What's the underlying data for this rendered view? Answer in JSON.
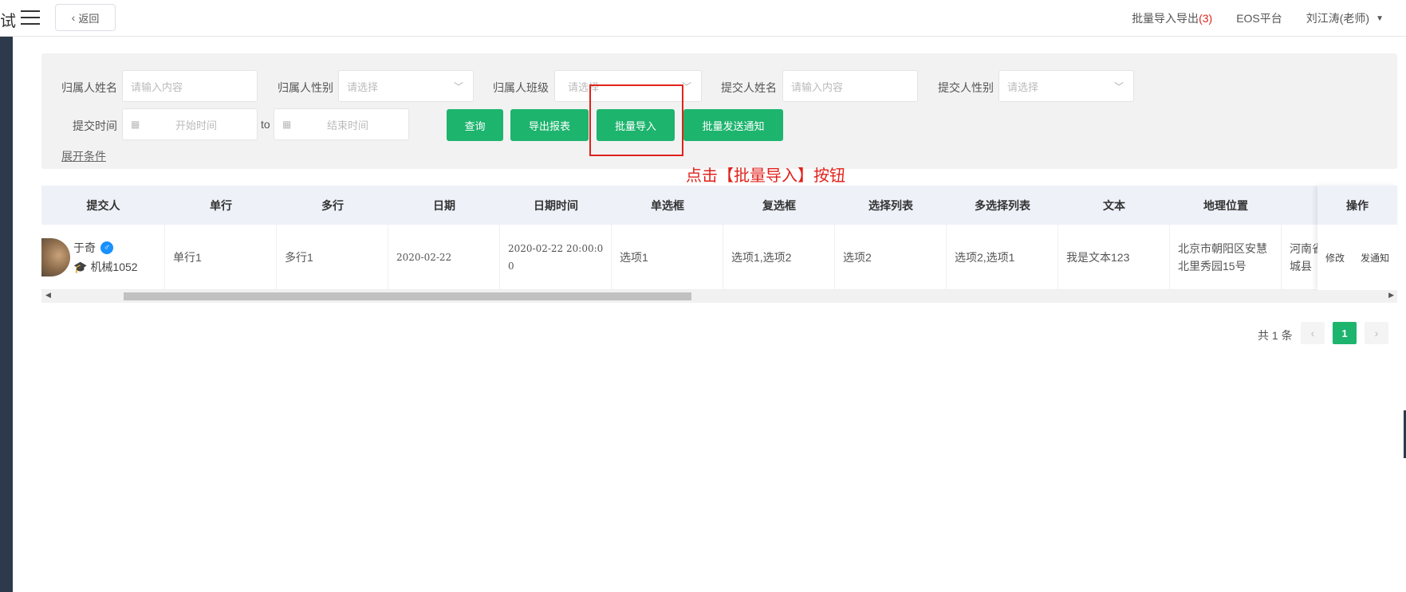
{
  "app": {
    "title_fragment": "试"
  },
  "topbar": {
    "back_label": "返回",
    "import_export_label": "批量导入导出",
    "import_export_count": "(3)",
    "eos_label": "EOS平台",
    "user_label": "刘江涛(老师)"
  },
  "filters": {
    "owner_name_label": "归属人姓名",
    "owner_name_placeholder": "请输入内容",
    "owner_gender_label": "归属人性别",
    "owner_gender_placeholder": "请选择",
    "owner_class_label": "归属人班级",
    "owner_class_placeholder": "请选择",
    "submitter_name_label": "提交人姓名",
    "submitter_name_placeholder": "请输入内容",
    "submitter_gender_label": "提交人性别",
    "submitter_gender_placeholder": "请选择",
    "submit_time_label": "提交时间",
    "start_placeholder": "开始时间",
    "to_label": "to",
    "end_placeholder": "结束时间",
    "expand_label": "展开条件"
  },
  "actions": {
    "query": "查询",
    "export_report": "导出报表",
    "batch_import": "批量导入",
    "batch_notify": "批量发送通知"
  },
  "annotation": "点击【批量导入】按钮",
  "table": {
    "headers": [
      "提交人",
      "单行",
      "多行",
      "日期",
      "日期时间",
      "单选框",
      "复选框",
      "选择列表",
      "多选择列表",
      "文本",
      "地理位置",
      "操作"
    ],
    "row": {
      "submitter_name": "于奇",
      "gender_symbol": "♂",
      "class_name": "机械1052",
      "single_line": "单行1",
      "multi_line": "多行1",
      "date": "2020-02-22",
      "datetime": "2020-02-22 20:00:00",
      "radio": "选项1",
      "checkbox": "选项1,选项2",
      "select": "选项2",
      "multi_select": "选项2,选项1",
      "text": "我是文本123",
      "location": "北京市朝阳区安慧北里秀园15号",
      "location2": "河南省城县",
      "op_edit": "修改",
      "op_notify": "发通知"
    }
  },
  "pagination": {
    "total": "共 1 条",
    "current": "1",
    "prev_icon": "‹",
    "next_icon": "›"
  },
  "colors": {
    "accent": "#1db46e",
    "highlight": "#e0221c",
    "sidebar": "#2d3a4b"
  }
}
